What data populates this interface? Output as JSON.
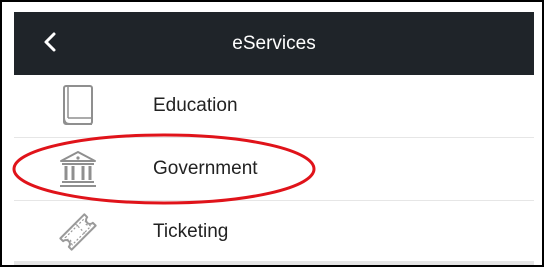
{
  "header": {
    "title": "eServices",
    "back_icon": "chevron-left-icon"
  },
  "items": [
    {
      "label": "Education",
      "icon": "book-icon"
    },
    {
      "label": "Government",
      "icon": "government-building-icon"
    },
    {
      "label": "Ticketing",
      "icon": "ticket-icon"
    }
  ],
  "colors": {
    "header_bg": "#1f2429",
    "header_text": "#ffffff",
    "highlight_circle": "#e0131a",
    "icon_stroke": "#9a9a9a"
  }
}
